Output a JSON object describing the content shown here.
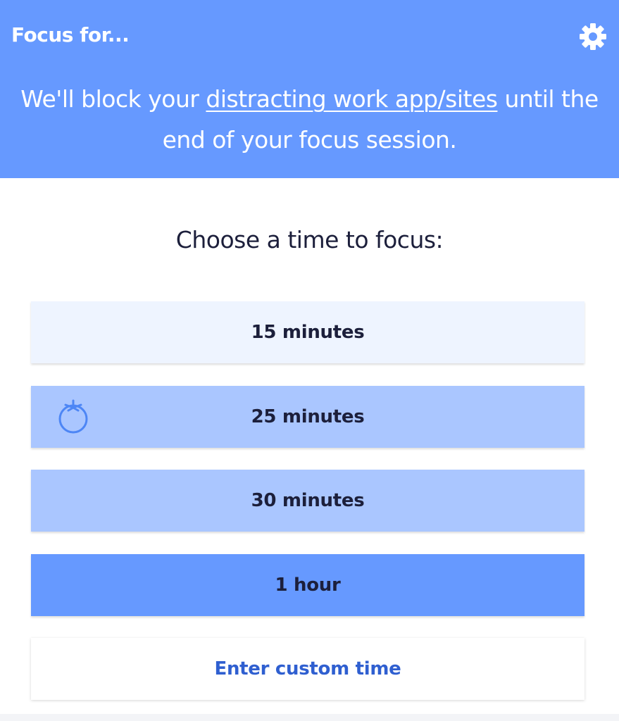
{
  "header": {
    "title": "Focus for...",
    "message_before": "We'll block your ",
    "message_link": "distracting work app/sites",
    "message_after": " until the end of your focus session.",
    "settings_icon": "gear-icon"
  },
  "prompt": "Choose a time to focus:",
  "options": [
    {
      "label": "15 minutes"
    },
    {
      "label": "25 minutes",
      "icon": "tomato-icon"
    },
    {
      "label": "30 minutes"
    },
    {
      "label": "1 hour"
    }
  ],
  "custom_option": "Enter custom time",
  "colors": {
    "primary": "#6699ff",
    "light": "#aac6ff",
    "lightest": "#eef4ff",
    "text_dark": "#1c1f3b",
    "link_blue": "#2f5fd0"
  }
}
